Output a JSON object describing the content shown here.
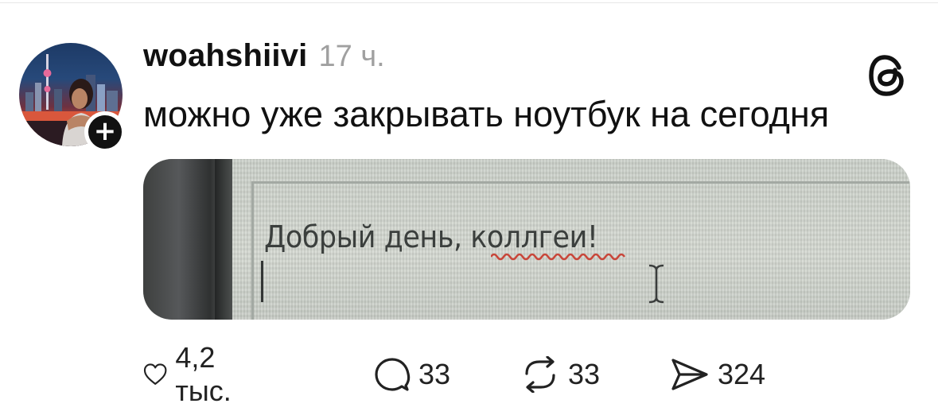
{
  "post": {
    "username": "woahshiivi",
    "time": "17 ч.",
    "text": "можно уже закрывать ноутбук на сегодня",
    "media": {
      "screen_text": "Добрый день, коллгеи!"
    }
  },
  "actions": {
    "like_count": "4,2 тыс.",
    "reply_count": "33",
    "repost_count": "33",
    "share_count": "324"
  },
  "icons": {
    "follow": "plus-icon",
    "app_logo": "threads-logo-icon",
    "like": "heart-icon",
    "reply": "comment-bubble-icon",
    "repost": "repost-arrows-icon",
    "share": "paper-plane-icon"
  },
  "colors": {
    "text": "#111111",
    "muted": "#a0a0a0",
    "follow_badge": "#111111",
    "spellcheck_underline": "#c8463a"
  }
}
